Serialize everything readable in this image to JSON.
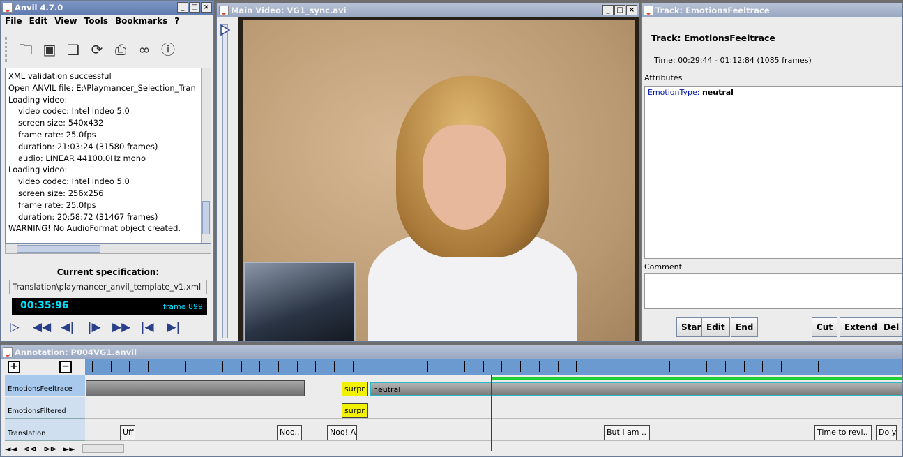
{
  "anvil": {
    "title": "Anvil 4.7.0",
    "menu": [
      "File",
      "Edit",
      "View",
      "Tools",
      "Bookmarks",
      "?"
    ],
    "log": [
      {
        "text": "XML validation successful",
        "indent": false
      },
      {
        "text": "Open ANVIL file: E:\\Playmancer_Selection_Tran",
        "indent": false
      },
      {
        "text": "Loading video:",
        "indent": false
      },
      {
        "text": "video codec: Intel Indeo 5.0",
        "indent": true
      },
      {
        "text": "screen size: 540x432",
        "indent": true
      },
      {
        "text": "frame rate: 25.0fps",
        "indent": true
      },
      {
        "text": "duration: 21:03:24 (31580 frames)",
        "indent": true
      },
      {
        "text": "audio: LINEAR 44100.0Hz mono",
        "indent": true
      },
      {
        "text": "Loading video:",
        "indent": false
      },
      {
        "text": "video codec: Intel Indeo 5.0",
        "indent": true
      },
      {
        "text": "screen size: 256x256",
        "indent": true
      },
      {
        "text": "frame rate: 25.0fps",
        "indent": true
      },
      {
        "text": "duration: 20:58:72 (31467 frames)",
        "indent": true
      },
      {
        "text": "WARNING! No AudioFormat object created.",
        "indent": false
      }
    ],
    "spec_title": "Current specification:",
    "spec_file": "Translation\\playmancer_anvil_template_v1.xml",
    "time": "00:35:96",
    "frame": "frame 899"
  },
  "video": {
    "title": "Main Video: VG1_sync.avi"
  },
  "track": {
    "title": "Track: EmotionsFeeltrace",
    "heading": "Track: EmotionsFeeltrace",
    "time": "Time: 00:29:44 - 01:12:84 (1085 frames)",
    "attributes_label": "Attributes",
    "attr_key": "EmotionType:",
    "attr_value": "neutral",
    "comment_label": "Comment",
    "buttons": {
      "start": "Start",
      "edit": "Edit",
      "end": "End",
      "cut": "Cut",
      "extend": "Extend",
      "delete": "Del"
    }
  },
  "annotation": {
    "title": "Annotation: P004VG1.anvil",
    "plus": "+",
    "minus": "−",
    "tracks": [
      "EmotionsFeeltrace",
      "EmotionsFiltered",
      "Translation"
    ],
    "segments": {
      "surpr1": "surpr...",
      "neutral": "neutral",
      "surpr2": "surpr...",
      "uff": "Uff",
      "noo": "Noo..",
      "nooal": "Noo! Al..",
      "butiam": "But I am ..",
      "timetorevi": "Time to revi..",
      "doy": "Do y.."
    },
    "nav": [
      "◄◄",
      "⊲⊲",
      "⊳⊳",
      "►►"
    ]
  }
}
